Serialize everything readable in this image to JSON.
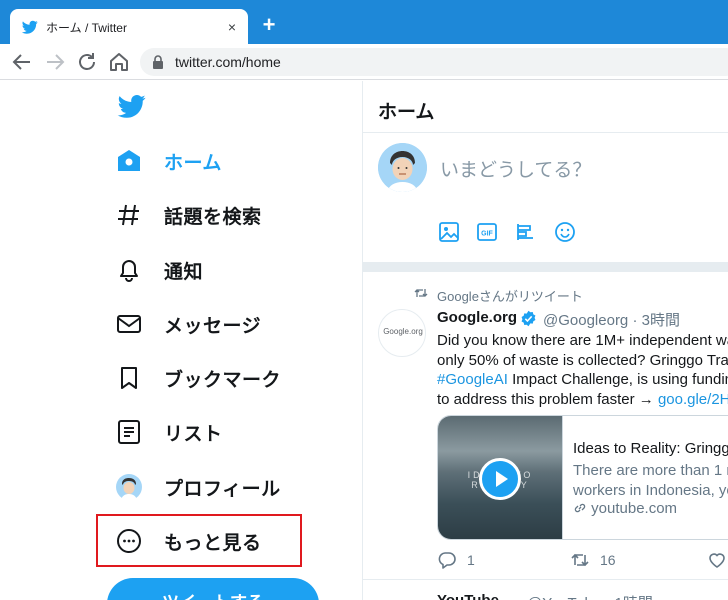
{
  "browser": {
    "tab_title": "ホーム / Twitter",
    "close_glyph": "×",
    "new_tab_glyph": "+",
    "url": "twitter.com/home"
  },
  "nav": {
    "items": [
      {
        "label": "ホーム",
        "icon": "home-icon",
        "active": true
      },
      {
        "label": "話題を検索",
        "icon": "hashtag-icon"
      },
      {
        "label": "通知",
        "icon": "bell-icon"
      },
      {
        "label": "メッセージ",
        "icon": "mail-icon"
      },
      {
        "label": "ブックマーク",
        "icon": "bookmark-icon"
      },
      {
        "label": "リスト",
        "icon": "list-icon"
      },
      {
        "label": "プロフィール",
        "icon": "avatar"
      },
      {
        "label": "もっと見る",
        "icon": "more-icon"
      }
    ],
    "tweet_button": "ツイートする"
  },
  "main": {
    "title": "ホーム",
    "compose_placeholder": "いまどうしてる？"
  },
  "tweet": {
    "retweet_text": "Googleさんがリツイート",
    "avatar_text": "Google.org",
    "name": "Google.org",
    "handle": "@Googleorg",
    "sep": "·",
    "time": "3時間",
    "lines": [
      "Did you know there are 1M+ independent wa",
      "only 50% of waste is collected? Gringgo Tra",
      "Impact Challenge, is using fundin",
      "to address this problem faster →"
    ],
    "hashtag": "#GoogleAI",
    "link": "goo.gle/2H",
    "card": {
      "thumb_text": "IDEAS TO REALITY",
      "title": "Ideas to Reality: Gringg",
      "desc_lines": [
        "There are more than 1 m",
        "workers in Indonesia, yo"
      ],
      "link": "youtube.com"
    },
    "replies": "1",
    "retweets": "16"
  },
  "next_tweet": {
    "name": "YouTube",
    "handle": "@YouTube · 1時間"
  },
  "colors": {
    "accent": "#1da1f2",
    "chrome": "#1e88d8",
    "highlight": "#e0191e"
  }
}
